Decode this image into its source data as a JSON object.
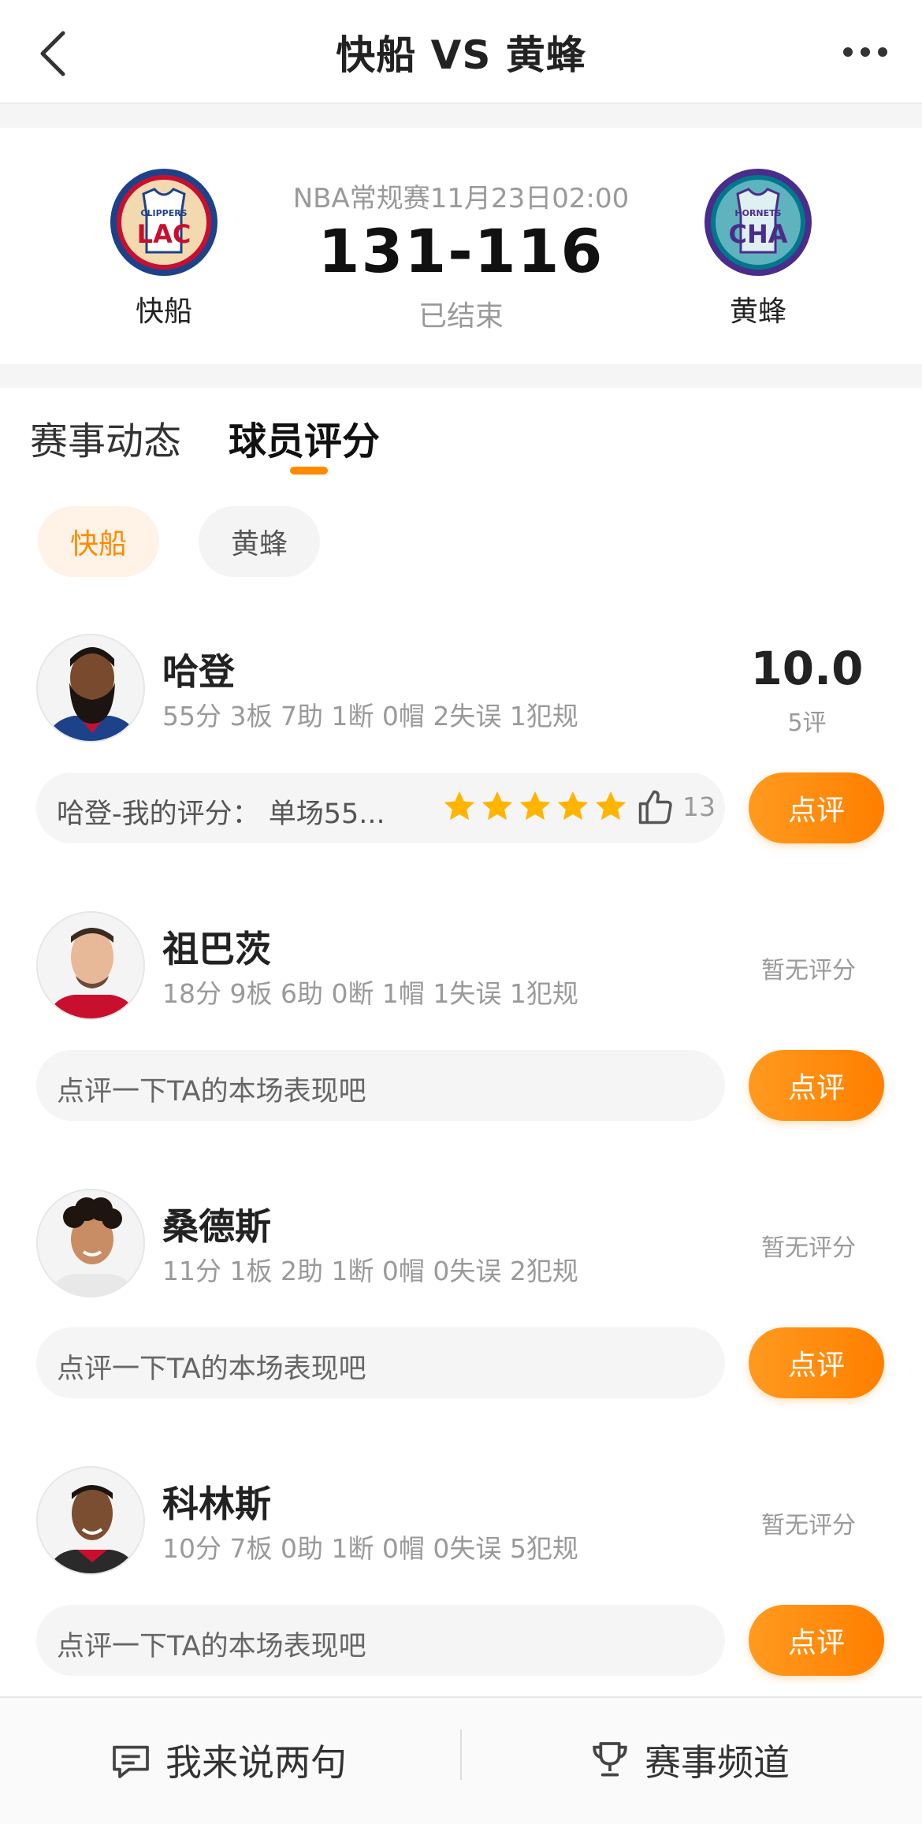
{
  "nav": {
    "title": "快船 VS 黄蜂"
  },
  "match": {
    "home": {
      "name": "快船",
      "logo_top": "CLIPPERS",
      "logo_abbr": "LAC"
    },
    "away": {
      "name": "黄蜂",
      "logo_top": "HORNETS",
      "logo_abbr": "CHA"
    },
    "meta": "NBA常规赛11月23日02:00",
    "score": "131-116",
    "status": "已结束"
  },
  "tabs": [
    {
      "label": "赛事动态"
    },
    {
      "label": "球员评分"
    }
  ],
  "team_filter": [
    {
      "label": "快船"
    },
    {
      "label": "黄蜂"
    }
  ],
  "players": [
    {
      "name": "哈登",
      "stats": "55分 3板 7助 1断 0帽 2失误 1犯规",
      "rating": "10.0",
      "rating_count": "5评",
      "comment_text": "哈登-我的评分：  单场55...",
      "stars": 5,
      "likes": "13",
      "button": "点评"
    },
    {
      "name": "祖巴茨",
      "stats": "18分 9板 6助 0断 1帽 1失误 1犯规",
      "no_rating": "暂无评分",
      "comment_prompt": "点评一下TA的本场表现吧",
      "button": "点评"
    },
    {
      "name": "桑德斯",
      "stats": "11分 1板 2助 1断 0帽 0失误 2犯规",
      "no_rating": "暂无评分",
      "comment_prompt": "点评一下TA的本场表现吧",
      "button": "点评"
    },
    {
      "name": "科林斯",
      "stats": "10分 7板 0助 1断 0帽 0失误 5犯规",
      "no_rating": "暂无评分",
      "comment_prompt": "点评一下TA的本场表现吧",
      "button": "点评"
    }
  ],
  "bottom": {
    "comment_label": "我来说两句",
    "channel_label": "赛事频道"
  },
  "colors": {
    "accent": "#ff8a00",
    "star": "#ffb400",
    "clippers_blue": "#1d428a",
    "clippers_red": "#c8102e",
    "hornets_teal": "#00788c",
    "hornets_purple": "#4a2d8a"
  }
}
